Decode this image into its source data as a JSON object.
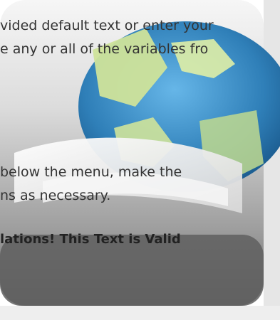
{
  "instructions": {
    "line1": "vided default text or enter your",
    "line2": "e any or all of the variables fro",
    "line3": "below the menu, make the",
    "line4": "ns as necessary."
  },
  "validation": {
    "message": "lations! This Text is Valid"
  },
  "background_icon": {
    "name": "globe-icon",
    "colors": {
      "tile_dark": "#5b5b5b",
      "tile_light": "#cfcfcf",
      "globe_blue": "#3f8fc8",
      "globe_green": "#d6e88a",
      "page_white": "#f4f4f4"
    }
  }
}
